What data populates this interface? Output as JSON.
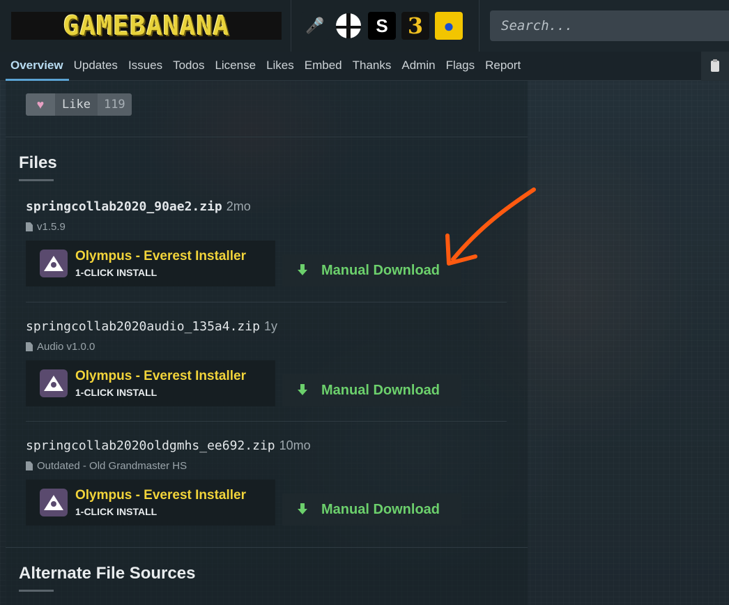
{
  "header": {
    "logo_text": "GAMEBANANA",
    "game_icons": [
      {
        "name": "friday-night-funkin-icon",
        "glyph": "🎤"
      },
      {
        "name": "smash-bros-icon",
        "glyph": ""
      },
      {
        "name": "celeste-icon",
        "glyph": "S"
      },
      {
        "name": "third-strike-icon",
        "glyph": "3"
      },
      {
        "name": "sonic-icon",
        "glyph": "●"
      }
    ],
    "search_placeholder": "Search..."
  },
  "nav": {
    "tabs": [
      "Overview",
      "Updates",
      "Issues",
      "Todos",
      "License",
      "Likes",
      "Embed",
      "Thanks",
      "Admin",
      "Flags",
      "Report"
    ],
    "active_tab": "Overview"
  },
  "like": {
    "heart": "♥",
    "label": "Like",
    "count": "119"
  },
  "files_section": {
    "title": "Files",
    "files": [
      {
        "name": "springcollab2020_90ae2.zip",
        "age": "2mo",
        "description": "v1.5.9",
        "installer_title": "Olympus - Everest Installer",
        "installer_sub": "1-CLICK INSTALL",
        "download_label": "Manual Download"
      },
      {
        "name": "springcollab2020audio_135a4.zip",
        "age": "1y",
        "description": "Audio v1.0.0",
        "installer_title": "Olympus - Everest Installer",
        "installer_sub": "1-CLICK INSTALL",
        "download_label": "Manual Download"
      },
      {
        "name": "springcollab2020oldgmhs_ee692.zip",
        "age": "10mo",
        "description": "Outdated - Old Grandmaster HS",
        "installer_title": "Olympus - Everest Installer",
        "installer_sub": "1-CLICK INSTALL",
        "download_label": "Manual Download"
      }
    ]
  },
  "alternate_section": {
    "title": "Alternate File Sources"
  },
  "colors": {
    "accent_yellow": "#f2d43a",
    "download_green": "#6cd06c",
    "annotation_orange": "#ff5a10",
    "active_tab_blue": "#5ba3d4"
  }
}
